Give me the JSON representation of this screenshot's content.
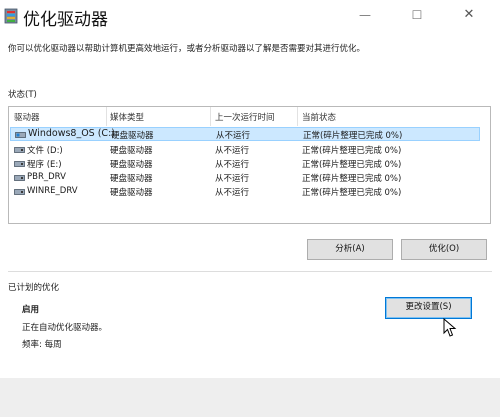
{
  "window": {
    "title": "优化驱动器",
    "description": "你可以优化驱动器以帮助计算机更高效地运行，或者分析驱动器以了解是否需要对其进行优化。"
  },
  "status": {
    "label": "状态(T)",
    "columns": [
      "驱动器",
      "媒体类型",
      "上一次运行时间",
      "当前状态"
    ],
    "rows": [
      {
        "drive": "Windows8_OS (C:)",
        "media": "硬盘驱动器",
        "last_run": "从不运行",
        "state": "正常(碎片整理已完成 0%)",
        "selected": true
      },
      {
        "drive": "文件 (D:)",
        "media": "硬盘驱动器",
        "last_run": "从不运行",
        "state": "正常(碎片整理已完成 0%)"
      },
      {
        "drive": "程序 (E:)",
        "media": "硬盘驱动器",
        "last_run": "从不运行",
        "state": "正常(碎片整理已完成 0%)"
      },
      {
        "drive": "PBR_DRV",
        "media": "硬盘驱动器",
        "last_run": "从不运行",
        "state": "正常(碎片整理已完成 0%)"
      },
      {
        "drive": "WINRE_DRV",
        "media": "硬盘驱动器",
        "last_run": "从不运行",
        "state": "正常(碎片整理已完成 0%)"
      }
    ]
  },
  "actions": {
    "analyze": "分析(A)",
    "optimize": "优化(O)"
  },
  "schedule": {
    "label": "已计划的优化",
    "enabled": "启用",
    "running_text": "正在自动优化驱动器。",
    "frequency": "频率: 每周",
    "change_settings": "更改设置(S)"
  },
  "colors": {
    "selection": "#cce8ff",
    "button": "#e1e1e1",
    "button_focus_border": "#0078d7"
  }
}
